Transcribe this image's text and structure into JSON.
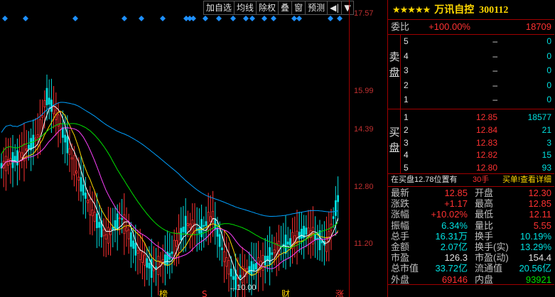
{
  "toolbar": {
    "items": [
      "加自选",
      "均线",
      "除权",
      "叠",
      "窗",
      "预测"
    ],
    "prev_icon": "◀|",
    "menu_icon": "▼"
  },
  "y_axis": {
    "ticks": [
      "17.57",
      "15.99",
      "14.39",
      "12.80",
      "11.20"
    ]
  },
  "chart_markers": {
    "low_label": "←10.00",
    "bottom_labels": [
      "榜",
      "S",
      "财",
      "涨"
    ]
  },
  "header": {
    "stars": "★★★★★",
    "name": "万讯自控",
    "code": "300112"
  },
  "weibi": {
    "label": "委比",
    "pct": "+100.00%",
    "diff": "18709"
  },
  "sell": {
    "side_label": [
      "卖",
      "盘"
    ],
    "levels": [
      {
        "n": "5",
        "price": "–",
        "vol": "0"
      },
      {
        "n": "4",
        "price": "–",
        "vol": "0"
      },
      {
        "n": "3",
        "price": "–",
        "vol": "0"
      },
      {
        "n": "2",
        "price": "–",
        "vol": "0"
      },
      {
        "n": "1",
        "price": "–",
        "vol": "0"
      }
    ]
  },
  "buy": {
    "side_label": [
      "买",
      "盘"
    ],
    "levels": [
      {
        "n": "1",
        "price": "12.85",
        "vol": "18577"
      },
      {
        "n": "2",
        "price": "12.84",
        "vol": "21"
      },
      {
        "n": "3",
        "price": "12.83",
        "vol": "3"
      },
      {
        "n": "4",
        "price": "12.82",
        "vol": "15"
      },
      {
        "n": "5",
        "price": "12.80",
        "vol": "93"
      }
    ]
  },
  "note": {
    "text": "在买盘12.78位置有",
    "qty": "30手",
    "link": "买单!查看详细"
  },
  "stats": [
    {
      "l1": "最新",
      "v1": "12.85",
      "c1": "red",
      "l2": "开盘",
      "v2": "12.30",
      "c2": "red"
    },
    {
      "l1": "涨跌",
      "v1": "+1.17",
      "c1": "red",
      "l2": "最高",
      "v2": "12.85",
      "c2": "red"
    },
    {
      "l1": "涨幅",
      "v1": "+10.02%",
      "c1": "red",
      "l2": "最低",
      "v2": "12.11",
      "c2": "red"
    },
    {
      "l1": "振幅",
      "v1": "6.34%",
      "c1": "cyan",
      "l2": "量比",
      "v2": "5.55",
      "c2": "red"
    },
    {
      "l1": "总手",
      "v1": "16.31万",
      "c1": "cyan",
      "l2": "换手",
      "v2": "10.19%",
      "c2": "cyan"
    },
    {
      "l1": "金额",
      "v1": "2.07亿",
      "c1": "cyan",
      "l2": "换手(实)",
      "v2": "13.29%",
      "c2": "cyan"
    },
    {
      "l1": "市盈",
      "v1": "126.3",
      "c1": "white",
      "l2": "市盈(动)",
      "v2": "154.4",
      "c2": "white"
    },
    {
      "l1": "总市值",
      "v1": "33.72亿",
      "c1": "cyan",
      "l2": "流通值",
      "v2": "20.56亿",
      "c2": "cyan"
    },
    {
      "l1": "外盘",
      "v1": "69146",
      "c1": "red",
      "l2": "内盘",
      "v2": "93921",
      "c2": "green"
    }
  ],
  "colors": {
    "up": "#ff3232",
    "down": "#00e0e0",
    "ma5": "#ffffff",
    "ma10": "#ffd800",
    "ma20": "#ff40ff",
    "ma30": "#00e000",
    "ma60": "#00a0ff",
    "marker": "#1e90ff",
    "border": "#a00000"
  }
}
